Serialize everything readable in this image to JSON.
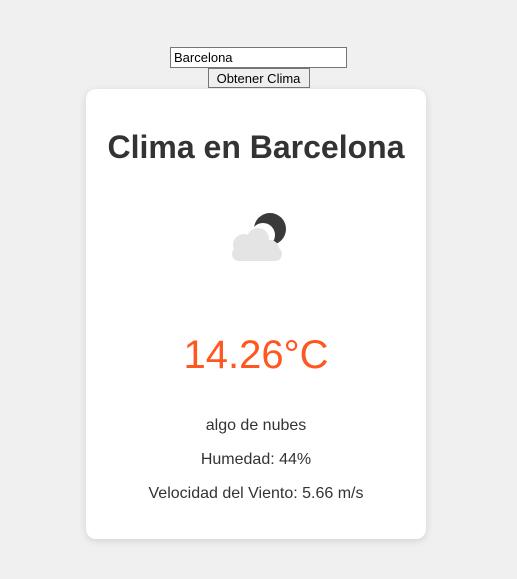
{
  "search": {
    "value": "Barcelona",
    "button_label": "Obtener Clima"
  },
  "weather": {
    "title": "Clima en Barcelona",
    "icon": "cloud-moon-icon",
    "temperature": "14.26°C",
    "description": "algo de nubes",
    "humidity": "Humedad: 44%",
    "wind": "Velocidad del Viento: 5.66 m/s"
  },
  "colors": {
    "background": "#f0f0f0",
    "card": "#ffffff",
    "text": "#333333",
    "temperature": "#ff5722"
  }
}
